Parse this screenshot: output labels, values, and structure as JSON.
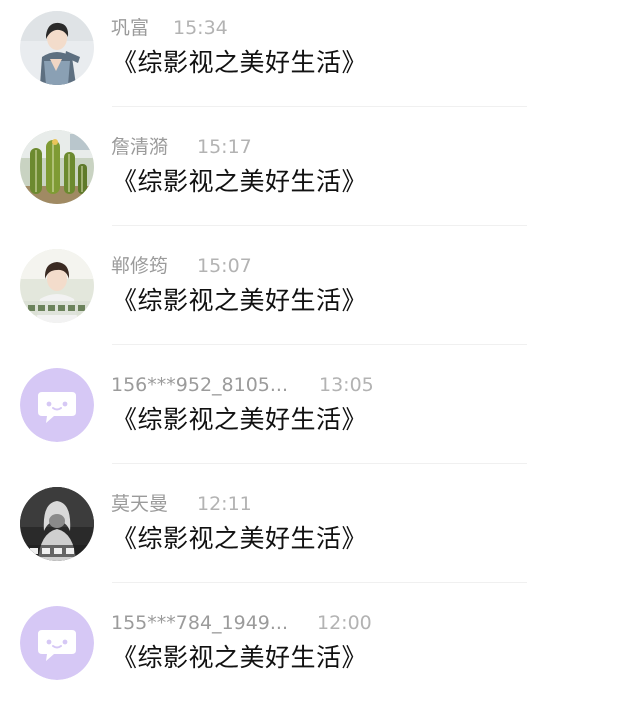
{
  "conversations": [
    {
      "name": "巩富",
      "time": "15:34",
      "message": "《综影视之美好生活》",
      "avatar": "photo-avatar-person"
    },
    {
      "name": "詹清漪",
      "time": "15:17",
      "message": "《综影视之美好生活》",
      "avatar": "photo-avatar-cactus"
    },
    {
      "name": "郸修筠",
      "time": "15:07",
      "message": "《综影视之美好生活》",
      "avatar": "photo-avatar-person"
    },
    {
      "name": "156***952_8105...",
      "time": "13:05",
      "message": "《综影视之美好生活》",
      "avatar": "chat-bubble-default-avatar"
    },
    {
      "name": "莫天曼",
      "time": "12:11",
      "message": "《综影视之美好生活》",
      "avatar": "photo-avatar-person"
    },
    {
      "name": "155***784_1949...",
      "time": "12:00",
      "message": "《综影视之美好生活》",
      "avatar": "chat-bubble-default-avatar"
    }
  ],
  "colors": {
    "default_avatar_bg": "#d6c8f5",
    "text_primary": "#111111",
    "text_secondary": "#9b9b9b"
  }
}
